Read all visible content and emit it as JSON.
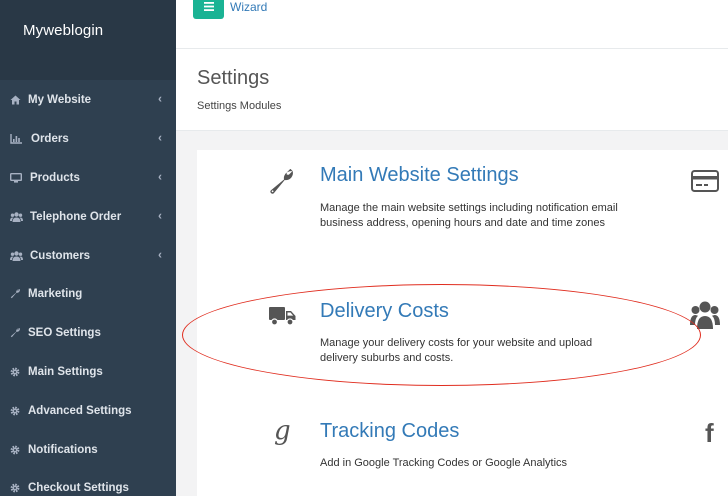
{
  "sidebar": {
    "brand": "Myweblogin",
    "items": [
      {
        "label": "My Website",
        "icon": "home-icon",
        "has_submenu": true
      },
      {
        "label": "Orders",
        "icon": "bar-chart-icon",
        "has_submenu": true
      },
      {
        "label": "Products",
        "icon": "desktop-icon",
        "has_submenu": true
      },
      {
        "label": "Telephone Order",
        "icon": "users-icon",
        "has_submenu": true
      },
      {
        "label": "Customers",
        "icon": "users-icon",
        "has_submenu": true
      },
      {
        "label": "Marketing",
        "icon": "wrench-icon",
        "has_submenu": false
      },
      {
        "label": "SEO Settings",
        "icon": "wrench-icon",
        "has_submenu": false
      },
      {
        "label": "Main Settings",
        "icon": "gear-icon",
        "has_submenu": false
      },
      {
        "label": "Advanced Settings",
        "icon": "gear-icon",
        "has_submenu": false
      },
      {
        "label": "Notifications",
        "icon": "gear-icon",
        "has_submenu": false
      },
      {
        "label": "Checkout Settings",
        "icon": "gear-icon",
        "has_submenu": false
      }
    ]
  },
  "topbar": {
    "wizard_label": "Wizard",
    "accent_color": "#1ab394"
  },
  "header": {
    "title": "Settings",
    "subtitle": "Settings Modules"
  },
  "modules": [
    {
      "title": "Main Website Settings",
      "description": "Manage the main website settings including notification email business address, opening hours and date and time zones",
      "icon": "wrench-icon"
    },
    {
      "title": "Delivery Costs",
      "description": "Manage your delivery costs for your website and upload delivery suburbs and costs.",
      "icon": "truck-icon"
    },
    {
      "title": "Tracking Codes",
      "description": "Add in Google Tracking Codes or Google Analytics",
      "icon": "google-icon",
      "icon_glyph": "g"
    }
  ],
  "side_icons": [
    "credit-card-icon",
    "users-icon",
    "facebook-icon"
  ],
  "side_glyph_facebook": "f",
  "annotation_color": "#e02d1f"
}
